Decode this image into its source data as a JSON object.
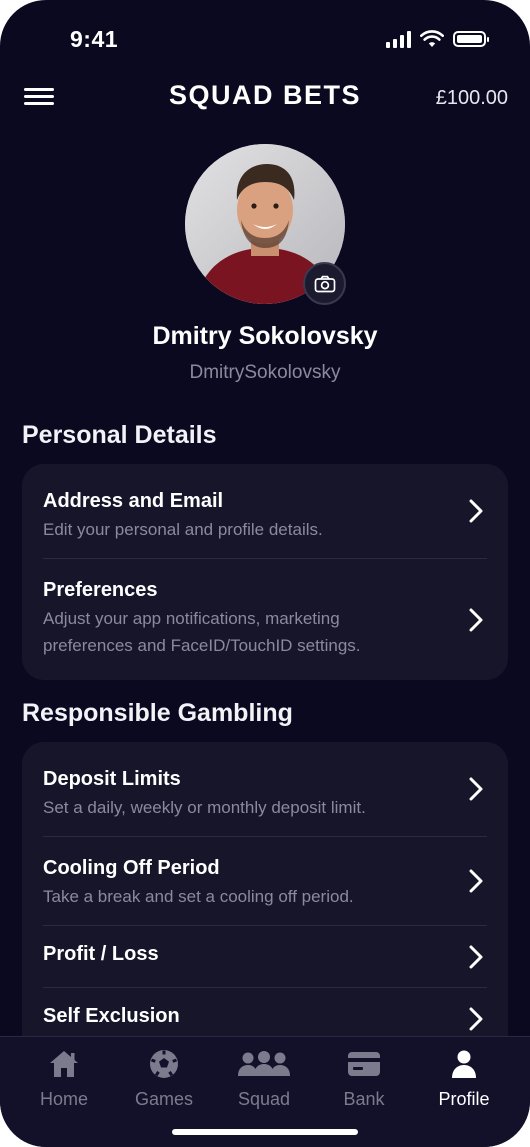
{
  "status_bar": {
    "time": "9:41"
  },
  "header": {
    "title": "SQUAD BETS",
    "balance": "£100.00"
  },
  "profile": {
    "name": "Dmitry Sokolovsky",
    "username": "DmitrySokolovsky"
  },
  "sections": [
    {
      "title": "Personal Details",
      "items": [
        {
          "title": "Address and Email",
          "subtitle": "Edit your personal and profile details."
        },
        {
          "title": "Preferences",
          "subtitle_line1": "Adjust your app notifications, marketing",
          "subtitle_line2": "preferences and FaceID/TouchID settings."
        }
      ]
    },
    {
      "title": "Responsible Gambling",
      "items": [
        {
          "title": "Deposit Limits",
          "subtitle": "Set a daily, weekly or monthly deposit limit."
        },
        {
          "title": "Cooling Off Period",
          "subtitle": "Take a break and set a cooling off period."
        },
        {
          "title": "Profit / Loss"
        },
        {
          "title": "Self Exclusion"
        }
      ]
    }
  ],
  "tabbar": {
    "items": [
      {
        "label": "Home",
        "icon": "home-icon"
      },
      {
        "label": "Games",
        "icon": "soccer-ball-icon"
      },
      {
        "label": "Squad",
        "icon": "group-icon"
      },
      {
        "label": "Bank",
        "icon": "card-icon"
      },
      {
        "label": "Profile",
        "icon": "person-icon"
      }
    ],
    "active": "Profile"
  },
  "colors": {
    "background": "#0b0920",
    "card": "#17152a",
    "tabbar": "#13112a",
    "muted_text": "#8b8a9d"
  }
}
